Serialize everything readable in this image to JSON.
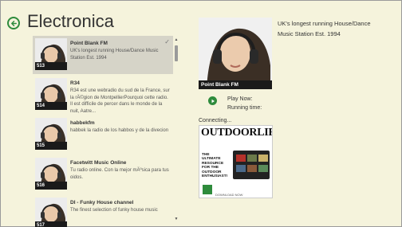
{
  "header": {
    "title": "Electronica"
  },
  "stations": [
    {
      "title": "Point Blank FM",
      "description": "UK's longest running House/Dance Music Station Est. 1994",
      "number": "513"
    },
    {
      "title": "R34",
      "description": "R34 est une webradio du sud de la France, sur la rÄ©gion de MontpellierPourquoi cette radio. Il est difficile de percer dans le monde de la nuit, Aatre...",
      "number": "514"
    },
    {
      "title": "habbekfm",
      "description": "habbek la radio de los habbos y de la divecion",
      "number": "515"
    },
    {
      "title": "Facetwitt Music Online",
      "description": "Tu radio online. Con la mejor mÄºsica para tus oidos.",
      "number": "516"
    },
    {
      "title": "DI - Funky House channel",
      "description": "The finest selection of funky house music",
      "number": "517"
    }
  ],
  "detail": {
    "art_label": "Point Blank FM",
    "description": "UK's longest running House/Dance Music Station Est. 1994",
    "play_now": "Play Now:",
    "running_time": "Running time:",
    "status": "Connecting..."
  },
  "ad": {
    "title": "OUTDOORLIFE",
    "body_lines": [
      "THE",
      "ULTIMATE",
      "RESOURCE",
      "FOR THE",
      "OUTDOOR",
      "ENTHUSIAST!"
    ],
    "cta": "DOWNLOAD NOW"
  },
  "colors": {
    "background": "#f5f3dc",
    "accent": "#2e8b3c",
    "selected": "#d6d4c8"
  }
}
